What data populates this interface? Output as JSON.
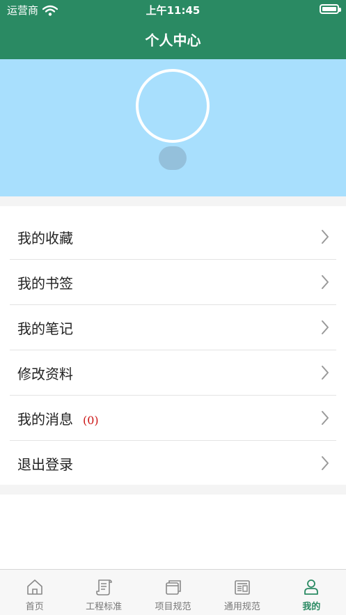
{
  "status_bar": {
    "carrier": "运营商",
    "time": "上午11:45"
  },
  "nav": {
    "title": "个人中心"
  },
  "menu": {
    "items": [
      {
        "label": "我的收藏"
      },
      {
        "label": "我的书签"
      },
      {
        "label": "我的笔记"
      },
      {
        "label": "修改资料"
      },
      {
        "label": "我的消息",
        "badge": "(0)"
      },
      {
        "label": "退出登录"
      }
    ]
  },
  "tabbar": {
    "active_index": 4,
    "tabs": [
      {
        "label": "首页",
        "icon": "home-icon"
      },
      {
        "label": "工程标准",
        "icon": "scroll-icon"
      },
      {
        "label": "项目规范",
        "icon": "stack-icon"
      },
      {
        "label": "通用规范",
        "icon": "newspaper-icon"
      },
      {
        "label": "我的",
        "icon": "user-icon"
      }
    ]
  },
  "colors": {
    "primary_green": "#2a8a63",
    "profile_bg": "#a8dffd",
    "badge_red": "#cc1414",
    "tab_inactive": "#777777"
  }
}
